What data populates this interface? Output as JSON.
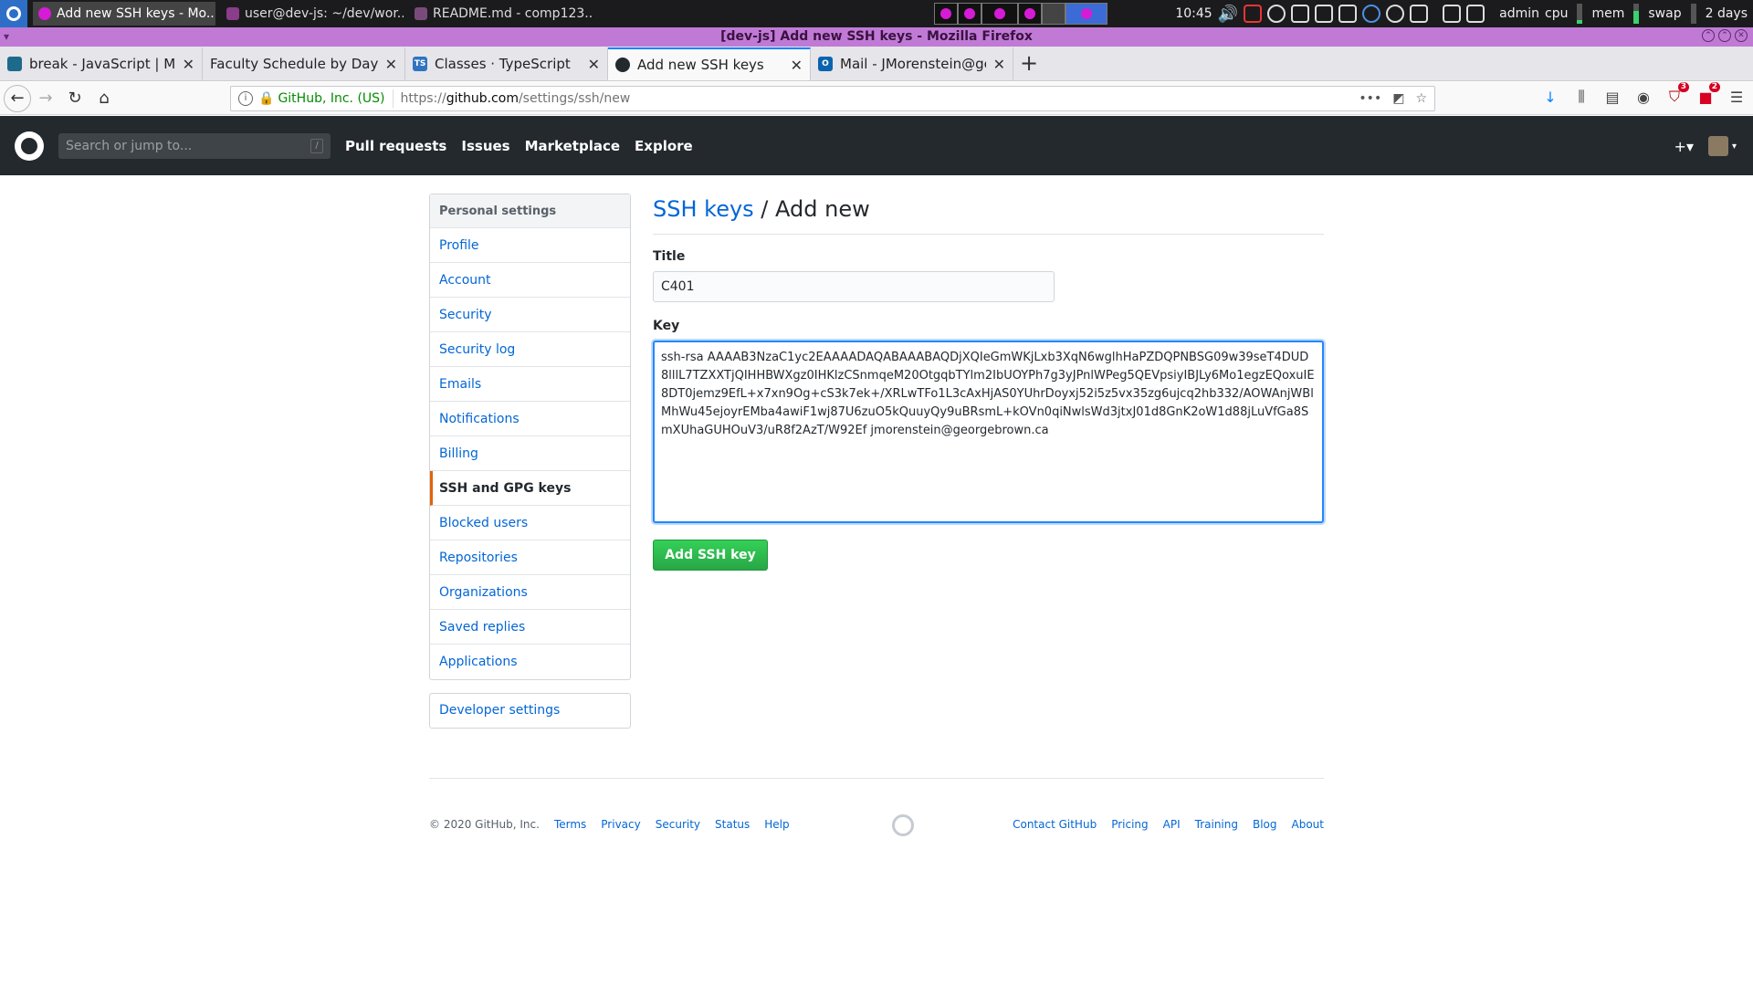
{
  "taskbar": {
    "tasks": [
      {
        "label": "Add new SSH keys - Mo...",
        "color": "#d61bd6",
        "active": true
      },
      {
        "label": "user@dev-js: ~/dev/wor...",
        "color": "#8a3d8a",
        "active": false
      },
      {
        "label": "README.md - comp123...",
        "color": "#7a4b7a",
        "active": false
      }
    ],
    "time": "10:45",
    "user": "admin",
    "cpu_label": "cpu",
    "mem_label": "mem",
    "swap_label": "swap",
    "uptime": "2 days"
  },
  "window": {
    "title": "[dev-js] Add new SSH keys - Mozilla Firefox"
  },
  "browser": {
    "tabs": [
      {
        "label": "break - JavaScript | MDN",
        "favicon": "mdn-icon",
        "color": "#1e6a8a"
      },
      {
        "label": "Faculty Schedule by Day and",
        "favicon": "blank-icon",
        "color": "transparent"
      },
      {
        "label": "Classes · TypeScript",
        "favicon": "ts-icon",
        "color": "#2f74c0"
      },
      {
        "label": "Add new SSH keys",
        "favicon": "github-icon",
        "color": "#24292e"
      },
      {
        "label": "Mail - JMorenstein@georg",
        "favicon": "outlook-icon",
        "color": "#0a64ad"
      }
    ],
    "org_label": "GitHub, Inc. (US)",
    "url_prefix": "https://",
    "url_domain": "github.com",
    "url_path": "/settings/ssh/new",
    "badges": {
      "ublock": "3",
      "ext": "2"
    }
  },
  "github": {
    "search_placeholder": "Search or jump to...",
    "search_hint": "/",
    "nav": [
      "Pull requests",
      "Issues",
      "Marketplace",
      "Explore"
    ]
  },
  "settings_menu": {
    "heading": "Personal settings",
    "items": [
      "Profile",
      "Account",
      "Security",
      "Security log",
      "Emails",
      "Notifications",
      "Billing",
      "SSH and GPG keys",
      "Blocked users",
      "Repositories",
      "Organizations",
      "Saved replies",
      "Applications"
    ],
    "selected": "SSH and GPG keys",
    "developer": "Developer settings"
  },
  "form": {
    "crumb_link": "SSH keys",
    "crumb_sep": " / ",
    "crumb_current": "Add new",
    "title_label": "Title",
    "title_value": "C401",
    "key_label": "Key",
    "key_value": "ssh-rsa AAAAB3NzaC1yc2EAAAADAQABAAABAQDjXQIeGmWKjLxb3XqN6wglhHaPZDQPNBSG09w39seT4DUD8lllL7TZXXTjQIHHBWXgz0IHKlzCSnmqeM20OtgqbTYlm2IbUOYPh7g3yJPnlWPeg5QEVpsiyIBJLy6Mo1egzEQoxuIE8DT0jemz9EfL+x7xn9Og+cS3k7ek+/XRLwTFo1L3cAxHjAS0YUhrDoyxj52i5z5vx35zg6ujcq2hb332/AOWAnjWBlMhWu45ejoyrEMba4awiF1wj87U6zuO5kQuuyQy9uBRsmL+kOVn0qiNwlsWd3jtxJ01d8GnK2oW1d88jLuVfGa8SmXUhaGUHOuV3/uR8f2AzT/W92Ef jmorenstein@georgebrown.ca",
    "submit_label": "Add SSH key"
  },
  "footer": {
    "copyright": "© 2020 GitHub, Inc.",
    "left_links": [
      "Terms",
      "Privacy",
      "Security",
      "Status",
      "Help"
    ],
    "right_links": [
      "Contact GitHub",
      "Pricing",
      "API",
      "Training",
      "Blog",
      "About"
    ]
  }
}
